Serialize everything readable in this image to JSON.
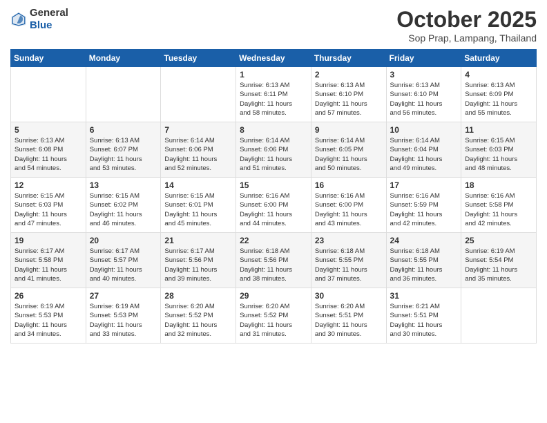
{
  "logo": {
    "general": "General",
    "blue": "Blue"
  },
  "header": {
    "month": "October 2025",
    "location": "Sop Prap, Lampang, Thailand"
  },
  "weekdays": [
    "Sunday",
    "Monday",
    "Tuesday",
    "Wednesday",
    "Thursday",
    "Friday",
    "Saturday"
  ],
  "weeks": [
    [
      {
        "day": "",
        "info": ""
      },
      {
        "day": "",
        "info": ""
      },
      {
        "day": "",
        "info": ""
      },
      {
        "day": "1",
        "info": "Sunrise: 6:13 AM\nSunset: 6:11 PM\nDaylight: 11 hours\nand 58 minutes."
      },
      {
        "day": "2",
        "info": "Sunrise: 6:13 AM\nSunset: 6:10 PM\nDaylight: 11 hours\nand 57 minutes."
      },
      {
        "day": "3",
        "info": "Sunrise: 6:13 AM\nSunset: 6:10 PM\nDaylight: 11 hours\nand 56 minutes."
      },
      {
        "day": "4",
        "info": "Sunrise: 6:13 AM\nSunset: 6:09 PM\nDaylight: 11 hours\nand 55 minutes."
      }
    ],
    [
      {
        "day": "5",
        "info": "Sunrise: 6:13 AM\nSunset: 6:08 PM\nDaylight: 11 hours\nand 54 minutes."
      },
      {
        "day": "6",
        "info": "Sunrise: 6:13 AM\nSunset: 6:07 PM\nDaylight: 11 hours\nand 53 minutes."
      },
      {
        "day": "7",
        "info": "Sunrise: 6:14 AM\nSunset: 6:06 PM\nDaylight: 11 hours\nand 52 minutes."
      },
      {
        "day": "8",
        "info": "Sunrise: 6:14 AM\nSunset: 6:06 PM\nDaylight: 11 hours\nand 51 minutes."
      },
      {
        "day": "9",
        "info": "Sunrise: 6:14 AM\nSunset: 6:05 PM\nDaylight: 11 hours\nand 50 minutes."
      },
      {
        "day": "10",
        "info": "Sunrise: 6:14 AM\nSunset: 6:04 PM\nDaylight: 11 hours\nand 49 minutes."
      },
      {
        "day": "11",
        "info": "Sunrise: 6:15 AM\nSunset: 6:03 PM\nDaylight: 11 hours\nand 48 minutes."
      }
    ],
    [
      {
        "day": "12",
        "info": "Sunrise: 6:15 AM\nSunset: 6:03 PM\nDaylight: 11 hours\nand 47 minutes."
      },
      {
        "day": "13",
        "info": "Sunrise: 6:15 AM\nSunset: 6:02 PM\nDaylight: 11 hours\nand 46 minutes."
      },
      {
        "day": "14",
        "info": "Sunrise: 6:15 AM\nSunset: 6:01 PM\nDaylight: 11 hours\nand 45 minutes."
      },
      {
        "day": "15",
        "info": "Sunrise: 6:16 AM\nSunset: 6:00 PM\nDaylight: 11 hours\nand 44 minutes."
      },
      {
        "day": "16",
        "info": "Sunrise: 6:16 AM\nSunset: 6:00 PM\nDaylight: 11 hours\nand 43 minutes."
      },
      {
        "day": "17",
        "info": "Sunrise: 6:16 AM\nSunset: 5:59 PM\nDaylight: 11 hours\nand 42 minutes."
      },
      {
        "day": "18",
        "info": "Sunrise: 6:16 AM\nSunset: 5:58 PM\nDaylight: 11 hours\nand 42 minutes."
      }
    ],
    [
      {
        "day": "19",
        "info": "Sunrise: 6:17 AM\nSunset: 5:58 PM\nDaylight: 11 hours\nand 41 minutes."
      },
      {
        "day": "20",
        "info": "Sunrise: 6:17 AM\nSunset: 5:57 PM\nDaylight: 11 hours\nand 40 minutes."
      },
      {
        "day": "21",
        "info": "Sunrise: 6:17 AM\nSunset: 5:56 PM\nDaylight: 11 hours\nand 39 minutes."
      },
      {
        "day": "22",
        "info": "Sunrise: 6:18 AM\nSunset: 5:56 PM\nDaylight: 11 hours\nand 38 minutes."
      },
      {
        "day": "23",
        "info": "Sunrise: 6:18 AM\nSunset: 5:55 PM\nDaylight: 11 hours\nand 37 minutes."
      },
      {
        "day": "24",
        "info": "Sunrise: 6:18 AM\nSunset: 5:55 PM\nDaylight: 11 hours\nand 36 minutes."
      },
      {
        "day": "25",
        "info": "Sunrise: 6:19 AM\nSunset: 5:54 PM\nDaylight: 11 hours\nand 35 minutes."
      }
    ],
    [
      {
        "day": "26",
        "info": "Sunrise: 6:19 AM\nSunset: 5:53 PM\nDaylight: 11 hours\nand 34 minutes."
      },
      {
        "day": "27",
        "info": "Sunrise: 6:19 AM\nSunset: 5:53 PM\nDaylight: 11 hours\nand 33 minutes."
      },
      {
        "day": "28",
        "info": "Sunrise: 6:20 AM\nSunset: 5:52 PM\nDaylight: 11 hours\nand 32 minutes."
      },
      {
        "day": "29",
        "info": "Sunrise: 6:20 AM\nSunset: 5:52 PM\nDaylight: 11 hours\nand 31 minutes."
      },
      {
        "day": "30",
        "info": "Sunrise: 6:20 AM\nSunset: 5:51 PM\nDaylight: 11 hours\nand 30 minutes."
      },
      {
        "day": "31",
        "info": "Sunrise: 6:21 AM\nSunset: 5:51 PM\nDaylight: 11 hours\nand 30 minutes."
      },
      {
        "day": "",
        "info": ""
      }
    ]
  ]
}
